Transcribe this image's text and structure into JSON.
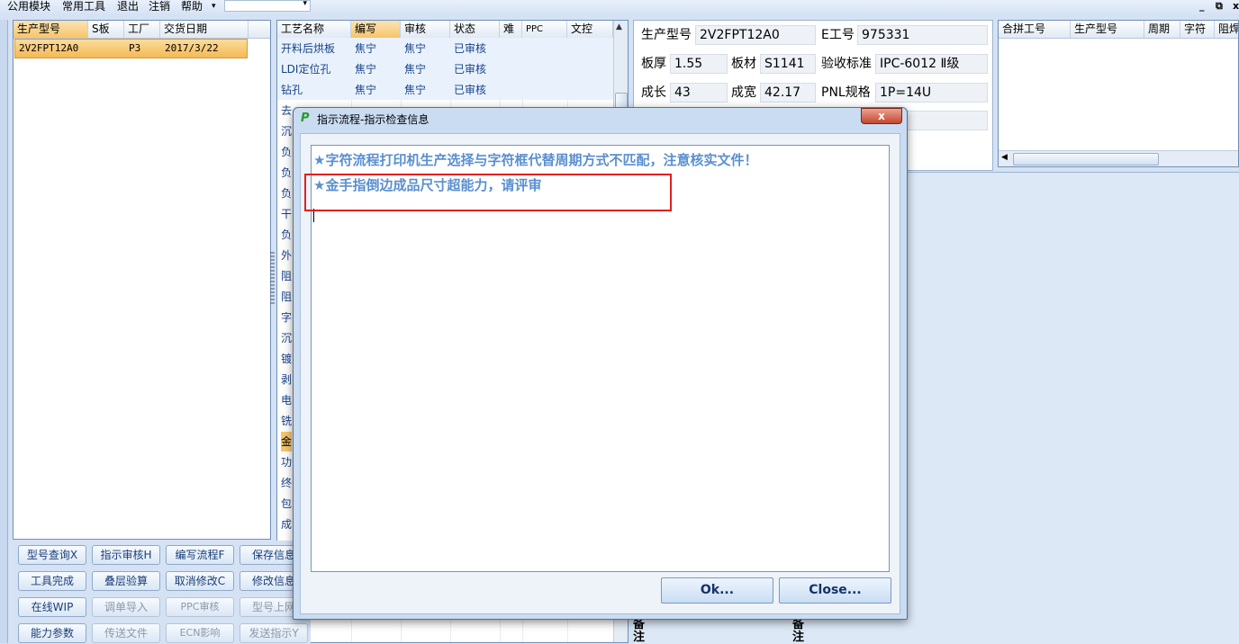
{
  "menubar": {
    "items": [
      "公用模块",
      "常用工具",
      "退出",
      "注销",
      "帮助"
    ],
    "help_arrow": "▾",
    "combo_value": "",
    "minimize": "_",
    "restore": "⧉",
    "close": "x"
  },
  "left_grid": {
    "headers": [
      "生产型号",
      "S板",
      "工厂",
      "交货日期"
    ],
    "rows": [
      [
        "2V2FPT12A0",
        "",
        "P3",
        "2017/3/22"
      ]
    ]
  },
  "process_grid": {
    "headers": [
      "工艺名称",
      "编写",
      "审核",
      "状态",
      "难",
      "PPC",
      "文控"
    ],
    "rows": [
      [
        "开料后烘板",
        "焦宁",
        "焦宁",
        "已审核"
      ],
      [
        "LDI定位孔",
        "焦宁",
        "焦宁",
        "已审核"
      ],
      [
        "钻孔",
        "焦宁",
        "焦宁",
        "已审核"
      ]
    ],
    "truncated_names": [
      "去",
      "沉",
      "负",
      "负",
      "负",
      "干",
      "负",
      "外",
      "阻",
      "阻",
      "字",
      "沉",
      "镀",
      "剥",
      "电",
      "铣",
      "金",
      "功",
      "终",
      "包",
      "成"
    ]
  },
  "buttons": [
    {
      "label": "型号查询X",
      "enabled": true
    },
    {
      "label": "指示审核H",
      "enabled": true
    },
    {
      "label": "编写流程F",
      "enabled": true
    },
    {
      "label": "保存信息",
      "enabled": true
    },
    {
      "label": "工具完成",
      "enabled": true
    },
    {
      "label": "叠层验算",
      "enabled": true
    },
    {
      "label": "取消修改C",
      "enabled": true
    },
    {
      "label": "修改信息",
      "enabled": true
    },
    {
      "label": "在线WIP",
      "enabled": true
    },
    {
      "label": "调单导入",
      "enabled": false
    },
    {
      "label": "PPC审核",
      "enabled": false
    },
    {
      "label": "型号上网",
      "enabled": false
    },
    {
      "label": "能力参数",
      "enabled": true
    },
    {
      "label": "传送文件",
      "enabled": false
    },
    {
      "label": "ECN影响",
      "enabled": false
    },
    {
      "label": "发送指示Y",
      "enabled": false
    }
  ],
  "info": {
    "model_label": "生产型号",
    "model_value": "2V2FPT12A0",
    "e_label": "E工号",
    "e_value": "975331",
    "thickness_label": "板厚",
    "thickness_value": "1.55",
    "material_label": "板材",
    "material_value": "S1141",
    "standard_label": "验收标准",
    "standard_value": "IPC-6012 Ⅱ级",
    "length_label": "成长",
    "length_value": "43",
    "width_label": "成宽",
    "width_value": "42.17",
    "pnl_label": "PNL规格",
    "pnl_value": "1P=14U",
    "note_label": "备注"
  },
  "merge_grid": {
    "headers": [
      "合拼工号",
      "生产型号",
      "周期",
      "字符",
      "阻焊"
    ]
  },
  "dialog": {
    "title": "指示流程-指示检查信息",
    "close_glyph": "x",
    "messages": [
      "★字符流程打印机生产选择与字符框代替周期方式不匹配，注意核实文件！",
      "★金手指倒边成品尺寸超能力，请评审"
    ],
    "ok_label": "Ok...",
    "close_label": "Close..."
  },
  "colors": {
    "accent": "#5a8fd0",
    "highlight_border": "#e02020",
    "selected_row": "#f6c56b"
  }
}
